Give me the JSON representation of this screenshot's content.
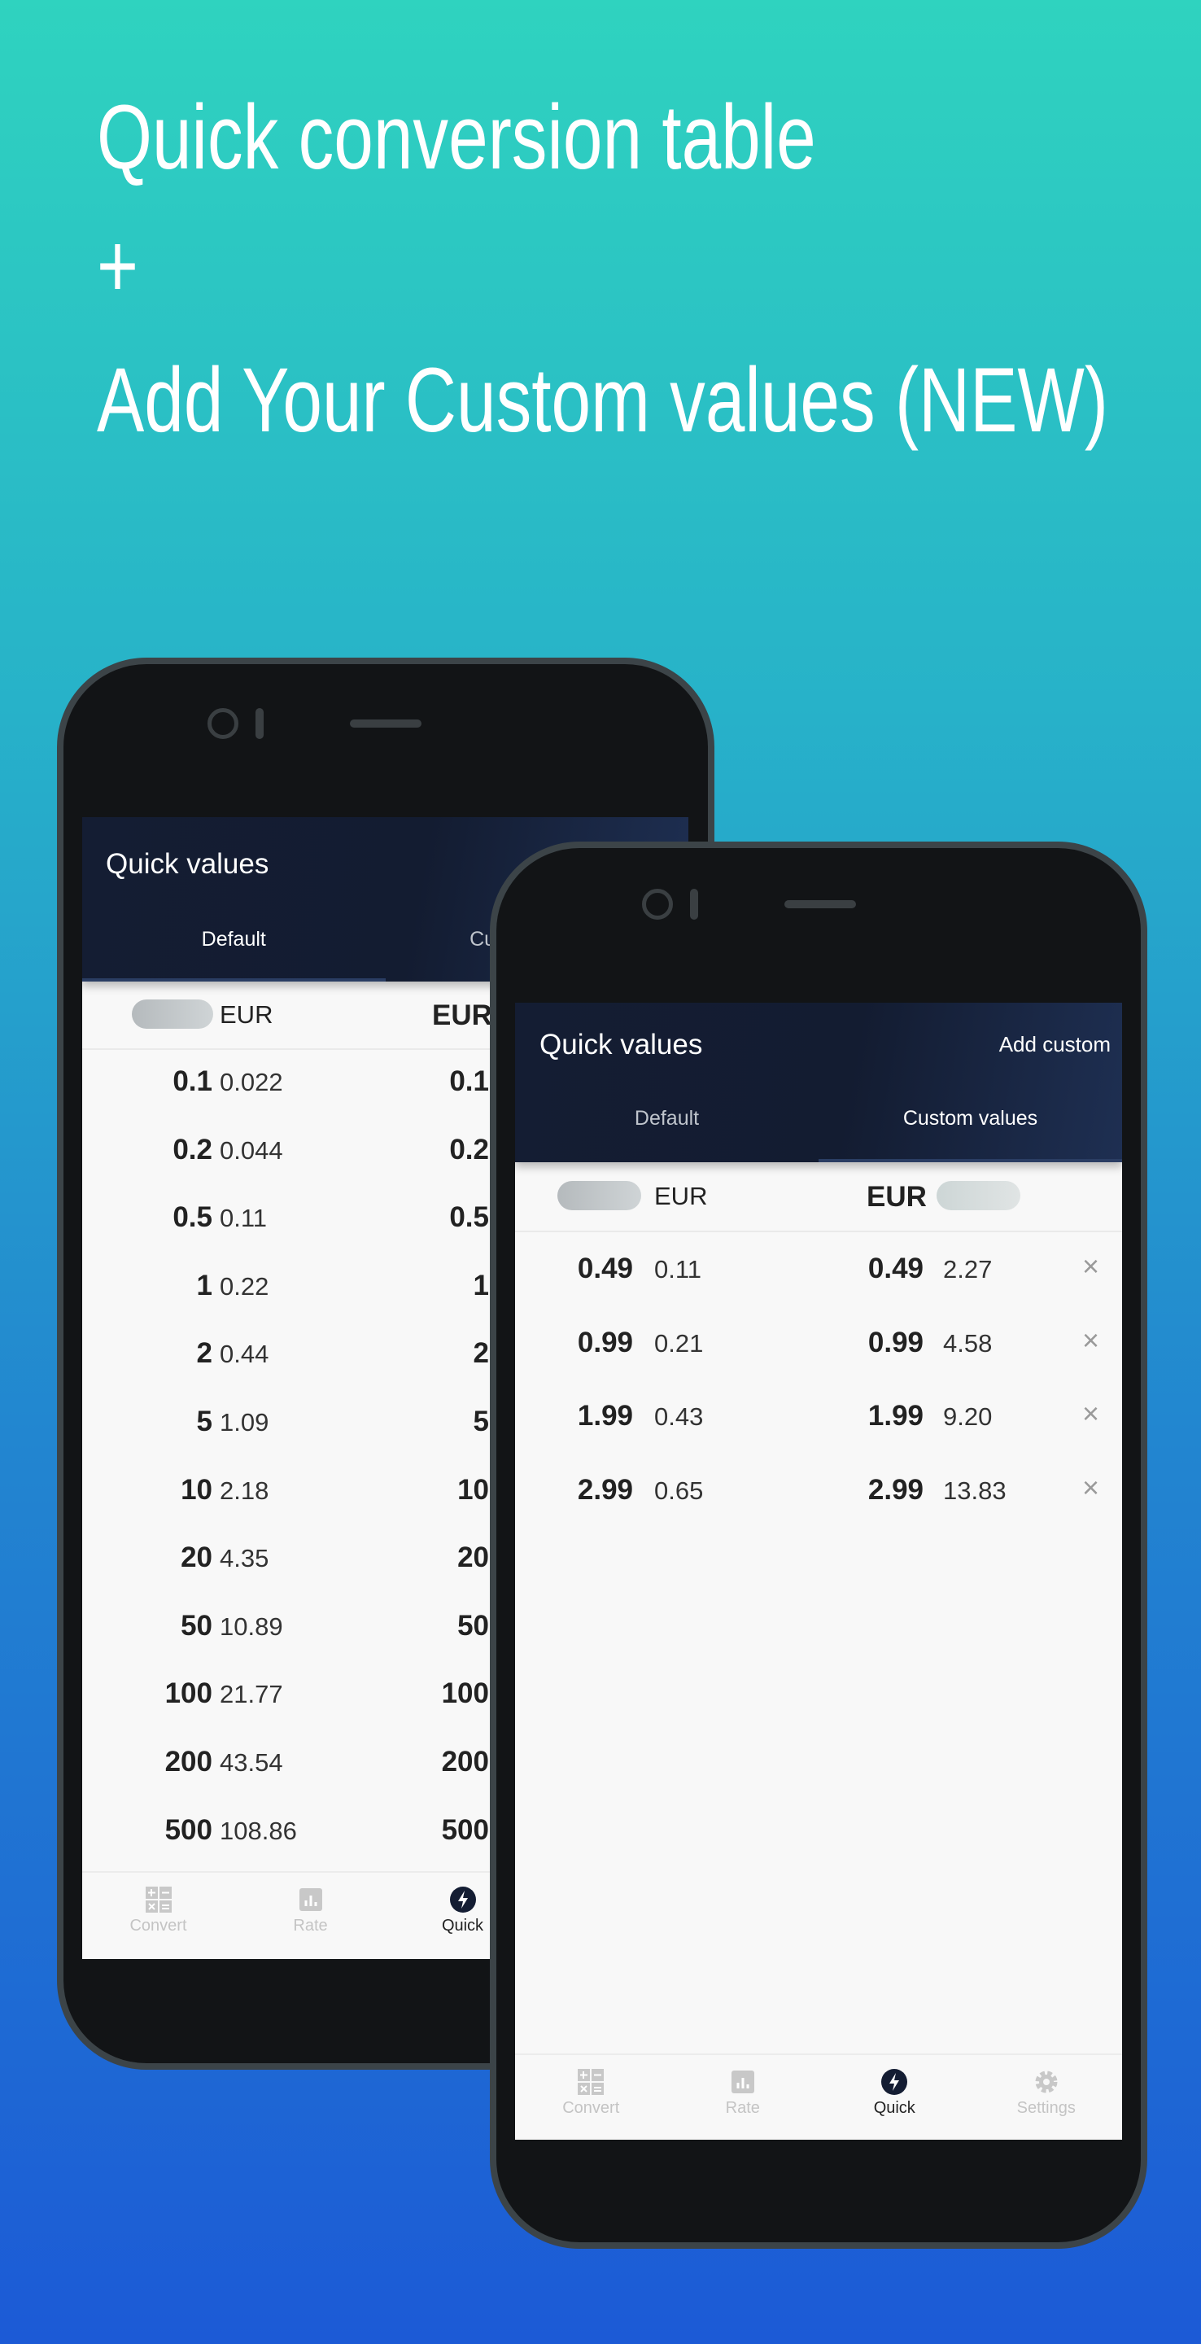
{
  "headline": {
    "line1": "Quick conversion table",
    "line2": "+",
    "line3": "Add Your Custom values (NEW)"
  },
  "colors": {
    "header": "#141d33",
    "accent": "#1c2540",
    "bg_top": "#2fd3bf",
    "bg_bottom": "#1c5ad6"
  },
  "back_phone": {
    "title": "Quick values",
    "tabs": [
      "Default",
      "Custom values"
    ],
    "from_currency": "EUR",
    "to_currency": "EUR",
    "rows": [
      {
        "num": "0.1",
        "val": "0.022"
      },
      {
        "num": "0.2",
        "val": "0.044"
      },
      {
        "num": "0.5",
        "val": "0.11"
      },
      {
        "num": "1",
        "val": "0.22"
      },
      {
        "num": "2",
        "val": "0.44"
      },
      {
        "num": "5",
        "val": "1.09"
      },
      {
        "num": "10",
        "val": "2.18"
      },
      {
        "num": "20",
        "val": "4.35"
      },
      {
        "num": "50",
        "val": "10.89"
      },
      {
        "num": "100",
        "val": "21.77"
      },
      {
        "num": "200",
        "val": "43.54"
      },
      {
        "num": "500",
        "val": "108.86"
      }
    ],
    "nav": [
      {
        "label": "Convert",
        "icon": "calculator-icon"
      },
      {
        "label": "Rate",
        "icon": "bar-chart-icon"
      },
      {
        "label": "Quick",
        "icon": "lightning-icon"
      }
    ]
  },
  "front_phone": {
    "title": "Quick values",
    "action": "Add custom",
    "tabs": [
      "Default",
      "Custom values"
    ],
    "from_currency": "EUR",
    "to_currency": "EUR",
    "rows": [
      {
        "left_num": "0.49",
        "left_val": "0.11",
        "right_num": "0.49",
        "right_val": "2.27"
      },
      {
        "left_num": "0.99",
        "left_val": "0.21",
        "right_num": "0.99",
        "right_val": "4.58"
      },
      {
        "left_num": "1.99",
        "left_val": "0.43",
        "right_num": "1.99",
        "right_val": "9.20"
      },
      {
        "left_num": "2.99",
        "left_val": "0.65",
        "right_num": "2.99",
        "right_val": "13.83"
      }
    ],
    "delete_icon": "×",
    "nav": [
      {
        "label": "Convert",
        "icon": "calculator-icon"
      },
      {
        "label": "Rate",
        "icon": "bar-chart-icon"
      },
      {
        "label": "Quick",
        "icon": "lightning-icon"
      },
      {
        "label": "Settings",
        "icon": "gear-icon"
      }
    ]
  }
}
